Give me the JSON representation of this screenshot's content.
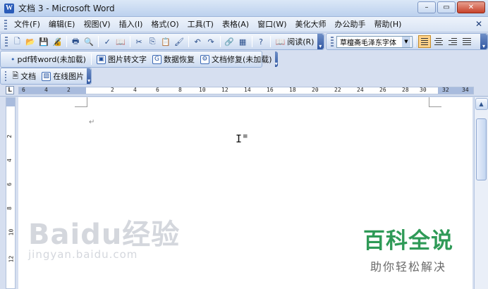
{
  "window": {
    "title": "文档 3 - Microsoft Word",
    "app_icon": "W",
    "minimize": "–",
    "restore": "▭",
    "close": "✕"
  },
  "menu": {
    "items": [
      "文件(F)",
      "编辑(E)",
      "视图(V)",
      "插入(I)",
      "格式(O)",
      "工具(T)",
      "表格(A)",
      "窗口(W)",
      "美化大师",
      "办公助手",
      "帮助(H)"
    ],
    "doc_close": "✕"
  },
  "toolbar_standard": {
    "read_label": "阅读(R)",
    "font_name": "草檀斋毛泽东字体"
  },
  "toolbar_addins": {
    "pdf_to_word": "pdf转word(未加载)",
    "image_to_text": "图片转文字",
    "data_recovery": "数据恢复",
    "doc_repair": "文档修复(未加载)"
  },
  "toolbar_doc": {
    "doc_label": "文档",
    "online_image": "在线图片"
  },
  "ruler": {
    "corner": "L",
    "h_numbers": [
      "6",
      "4",
      "2",
      "2",
      "4",
      "6",
      "8",
      "10",
      "12",
      "14",
      "16",
      "18",
      "20",
      "22",
      "24",
      "26",
      "28",
      "30",
      "32",
      "34"
    ],
    "v_numbers": [
      "2",
      "4",
      "6",
      "8",
      "10",
      "12"
    ]
  },
  "document": {
    "paragraph_mark": "↵"
  },
  "watermark": {
    "brand": "Baidu经验",
    "url": "jingyan.baidu.com"
  },
  "baike": {
    "title": "百科全说",
    "subtitle": "助你轻松解决"
  },
  "colors": {
    "accent": "#2f9a57",
    "chrome": "#d6dff0"
  }
}
